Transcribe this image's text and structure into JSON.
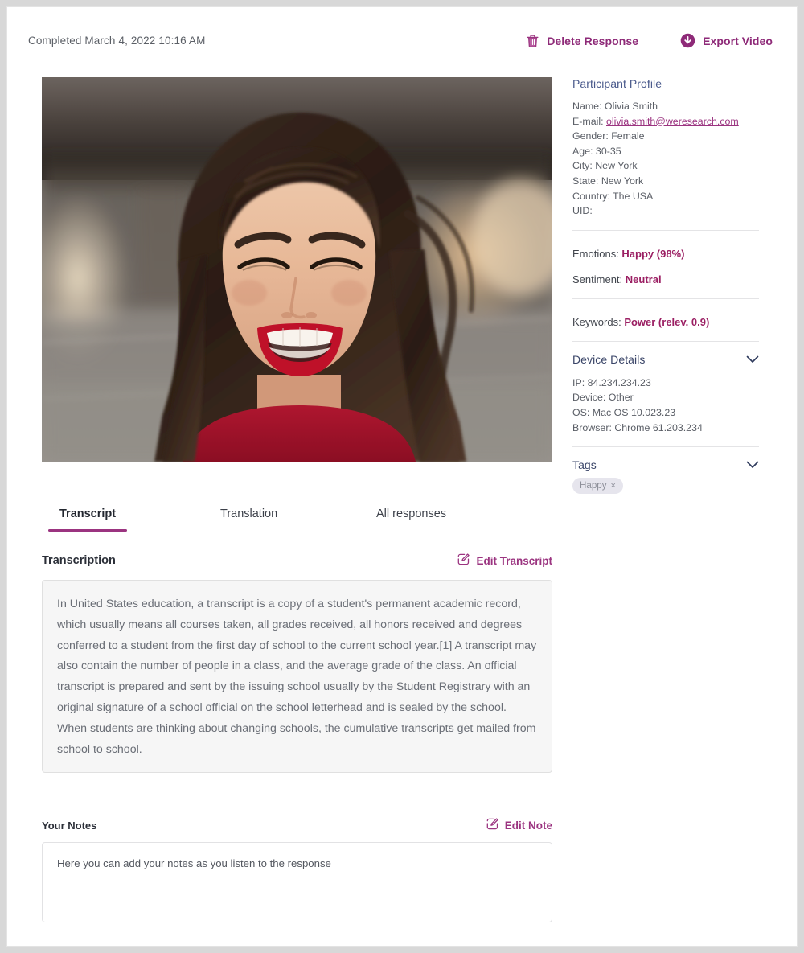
{
  "topbar": {
    "completed_label": "Completed March 4, 2022 10:16 AM",
    "delete_label": "Delete Response",
    "export_label": "Export Video",
    "delete_icon": "trash-icon",
    "export_icon": "download-circle-icon"
  },
  "media": {
    "alt": "Participant video still: smiling woman with dark hair and red lipstick wearing a red top, blurred urban background"
  },
  "tabs": [
    {
      "label": "Transcript",
      "active": true
    },
    {
      "label": "Translation",
      "active": false
    },
    {
      "label": "All responses",
      "active": false
    }
  ],
  "transcription": {
    "title": "Transcription",
    "edit_label": "Edit Transcript",
    "edit_icon": "pencil-square-icon",
    "text": "In United States education, a transcript is a copy of a student's permanent academic record, which usually means all courses taken, all grades received, all honors received and degrees conferred to a student from the first day of school to the current school year.[1] A transcript may also contain the number of people in a class, and the average grade of the class. An official transcript is prepared and sent by the issuing school usually by the Student Registrary with an original signature of a school official on the school letterhead and is sealed by the school. When students are thinking about changing schools, the cumulative transcripts get mailed from school to school."
  },
  "notes": {
    "title": "Your Notes",
    "edit_label": "Edit Note",
    "edit_icon": "pencil-square-icon",
    "placeholder": "Here you can add your notes as you listen to the response",
    "value": ""
  },
  "sidebar": {
    "profile": {
      "title": "Participant Profile",
      "name": "Name: Olivia Smith",
      "email_label": "E-mail: ",
      "email_value": "olivia.smith@weresearch.com",
      "gender": "Gender: Female",
      "age": "Age: 30-35",
      "city": "City: New York",
      "state": "State: New York",
      "country": "Country: The USA",
      "uid": "UID:"
    },
    "analysis": {
      "emotions_label": "Emotions: ",
      "emotions_value": "Happy (98%)",
      "sentiment_label": "Sentiment: ",
      "sentiment_value": "Neutral",
      "keywords_label": "Keywords: ",
      "keywords_value": "Power (relev. 0.9)"
    },
    "device": {
      "title": "Device Details",
      "chevron_icon": "chevron-down-icon",
      "ip": "IP: 84.234.234.23",
      "device": "Device: Other",
      "os": "OS: Mac OS 10.023.23",
      "browser": "Browser: Chrome 61.203.234"
    },
    "tags": {
      "title": "Tags",
      "chevron_icon": "chevron-down-icon",
      "items": [
        {
          "label": "Happy",
          "remove": "×"
        }
      ]
    }
  },
  "colors": {
    "accent_purple": "#9b3480",
    "accent_magenta": "#9b1f63",
    "navy": "#3a4568",
    "profile_title": "#4a5a8c",
    "body_gray": "#5a5e66",
    "panel_bg": "#f6f6f6"
  }
}
